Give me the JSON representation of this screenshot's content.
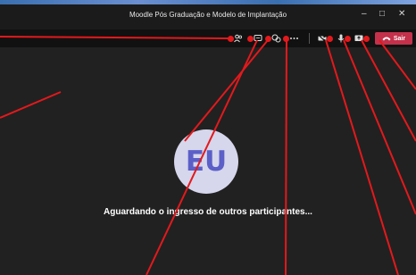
{
  "window": {
    "title": "Moodle Pós Graduação e Modelo de Implantação",
    "minimize_symbol": "–",
    "maximize_symbol": "□",
    "close_symbol": "✕"
  },
  "toolbar": {
    "leave_label": "Sair",
    "items": [
      {
        "name": "participants-icon"
      },
      {
        "name": "chat-icon"
      },
      {
        "name": "reactions-icon"
      },
      {
        "name": "more-actions-icon"
      },
      {
        "name": "camera-icon"
      },
      {
        "name": "microphone-icon"
      },
      {
        "name": "share-screen-icon"
      },
      {
        "name": "phone-hangup-icon"
      }
    ]
  },
  "stage": {
    "avatar_initials": "EU",
    "waiting_message": "Aguardando o ingresso de outros participantes..."
  },
  "colors": {
    "accent_red": "#e3191c",
    "leave_button": "#c4314b",
    "avatar_bg": "#d6d6ec",
    "avatar_text": "#5b5fc7"
  }
}
